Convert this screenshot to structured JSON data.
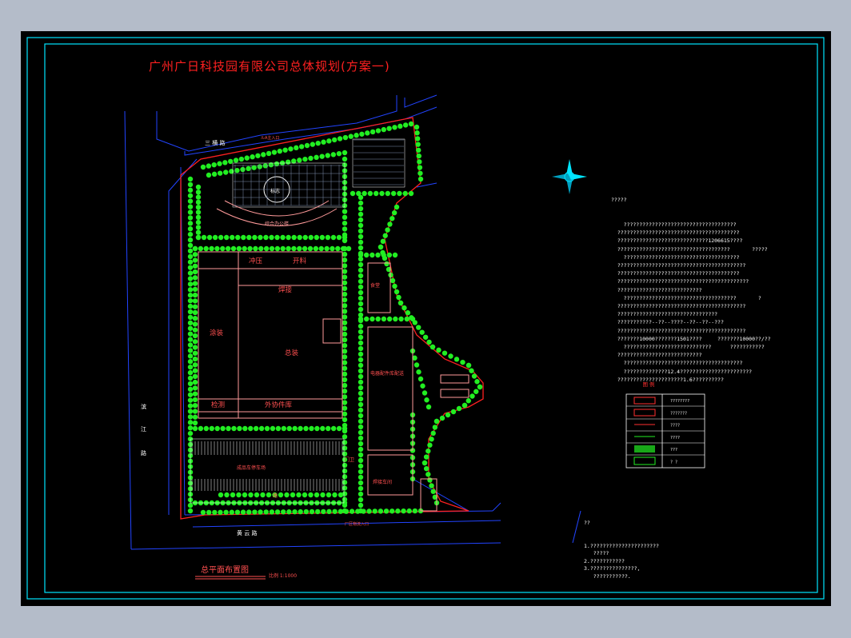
{
  "drawing": {
    "title": "广州广日科技园有限公司总体规划(方案一)",
    "plan_label": "总平面布置图",
    "scale_label": "比例 1:1000"
  },
  "roads": {
    "top": "三 横 路",
    "bottom": "黄 云 路",
    "left": [
      "滨",
      "江",
      "路"
    ]
  },
  "entrances": {
    "top_gate": "ルA主入口",
    "bottom_gate": "厂区物流入口"
  },
  "buildings": {
    "plaza_label": "综合办公楼",
    "circle_label": "标志",
    "row_top_left": "冲压",
    "row_top_right": "开料",
    "welding": "焊接",
    "painting": "涂装",
    "assembly": "总装",
    "inspection": "检测",
    "outsourced": "外协件库",
    "small_bldg": "食堂",
    "tall_bldg": "电器配件库配送",
    "parking": "成品车停车场",
    "bottom_strip": "路",
    "lower_bldg": "焊接车间",
    "gate_small": "门卫"
  },
  "notes": {
    "header": "?????",
    "lines": [
      "    ????????????????????????????????????",
      "  ???????????????????????????????????????",
      "  ?????????????????????????????1206615????",
      "  ????????????????????????????????????       ?????",
      "    ?????????????????????????????????????",
      "  ?????????????????????????????????????????",
      "  ???????????????????????????????????????",
      "  ??????????????????????????????????????????",
      "  ???????????????????????????",
      "    ????????????????????????????????????       ?",
      "  ?????????????????????????????????????????",
      "  ????????????????????????????????",
      "  ???????????--??--????--??--??--???",
      "  ?????????????????????????????????????????",
      "  ???????10000???????1501????     ???????10000??/??",
      "    ????????????????????????????      ???????????",
      "  ???????????????????????????",
      "    ??????????????????????????????????????",
      "    ??????????????12.4???????????????????????",
      "  ?????????????????????1.6??????????"
    ]
  },
  "legend": {
    "title": "图 例",
    "rows": [
      "????????",
      "???????",
      "????",
      "????",
      "???",
      "? ?"
    ]
  },
  "footnote": {
    "header": "??",
    "lines": [
      "1.??????????????????????",
      "   ?????",
      "2.???????????",
      "3.???????????????,",
      "   ???????????."
    ]
  },
  "colors": {
    "sheet": "#000000",
    "frame": "#00e5ff",
    "road": "#2040ff",
    "wall": "#ff2020",
    "tree": "#22ee22",
    "building": "#ffb0b0",
    "text": "#ffffff"
  }
}
